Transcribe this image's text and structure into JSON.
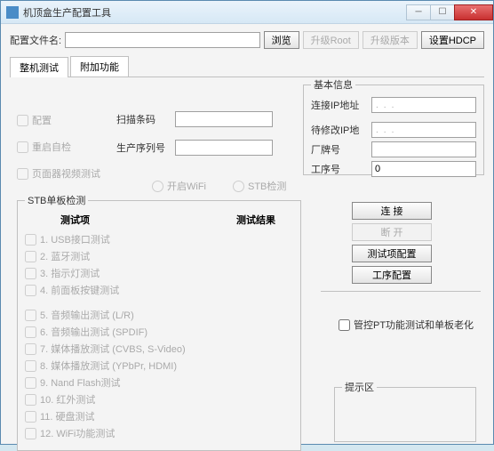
{
  "window": {
    "title": "机顶盒生产配置工具"
  },
  "toprow": {
    "config_label": "配置文件名:",
    "config_value": "",
    "browse": "浏览",
    "upgrade_root": "升级Root",
    "upgrade_ver": "升级版本",
    "set_hdcp": "设置HDCP"
  },
  "tabs": {
    "t1": "整机测试",
    "t2": "附加功能"
  },
  "leftchecks": {
    "c1": "配置",
    "c2": "重启自检",
    "c3": "页面器视频测试"
  },
  "midlabels": {
    "barcode": "扫描条码",
    "sn": "生产序列号"
  },
  "midvals": {
    "barcode": "",
    "sn": ""
  },
  "radios": {
    "r1": "开启WiFi",
    "r2": "STB检测"
  },
  "basic": {
    "legend": "基本信息",
    "ip_label": "连接IP地址",
    "mod_ip_label": "待修改IP地",
    "factory_label": "厂牌号",
    "factory_val": "",
    "station_label": "工序号",
    "station_val": "0"
  },
  "stb": {
    "legend": "STB单板检测",
    "col1": "测试项",
    "col2": "测试结果",
    "items": {
      "i1": "1. USB接口测试",
      "i2": "2. 蓝牙测试",
      "i3": "3. 指示灯测试",
      "i4": "4. 前面板按键测试",
      "i5": "5. 音频输出测试 (L/R)",
      "i6": "6. 音频输出测试 (SPDIF)",
      "i7": "7. 媒体播放测试 (CVBS, S-Video)",
      "i8": "8. 媒体播放测试 (YPbPr, HDMI)",
      "i9": "9. Nand Flash测试",
      "i10": "10. 红外测试",
      "i11": "11. 硬盘测试",
      "i12": "12. WiFi功能测试"
    }
  },
  "rbtns": {
    "b1": "连  接",
    "b2": "断  开",
    "b3": "测试项配置",
    "b4": "工序配置"
  },
  "ctrl_chk": "管控PT功能测试和单板老化",
  "hint": {
    "legend": "提示区"
  }
}
